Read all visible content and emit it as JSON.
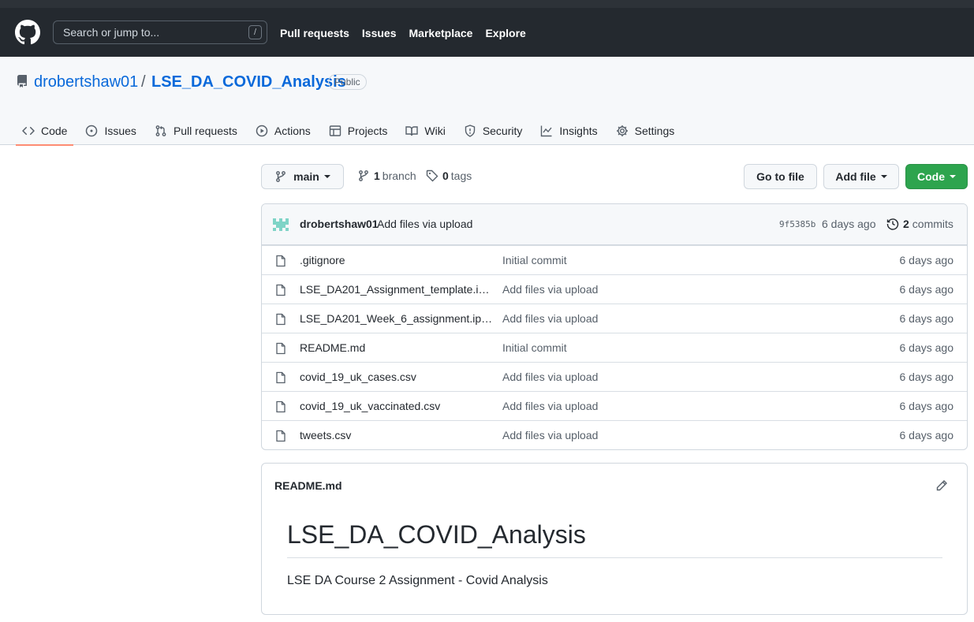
{
  "header": {
    "search_placeholder": "Search or jump to...",
    "search_shortcut": "/",
    "nav": [
      "Pull requests",
      "Issues",
      "Marketplace",
      "Explore"
    ]
  },
  "repo": {
    "owner": "drobertshaw01",
    "separator": "/",
    "name": "LSE_DA_COVID_Analysis",
    "visibility": "Public"
  },
  "tabs": [
    {
      "label": "Code",
      "icon": "code-icon"
    },
    {
      "label": "Issues",
      "icon": "issue-icon"
    },
    {
      "label": "Pull requests",
      "icon": "pull-request-icon"
    },
    {
      "label": "Actions",
      "icon": "play-icon"
    },
    {
      "label": "Projects",
      "icon": "table-icon"
    },
    {
      "label": "Wiki",
      "icon": "book-icon"
    },
    {
      "label": "Security",
      "icon": "shield-icon"
    },
    {
      "label": "Insights",
      "icon": "graph-icon"
    },
    {
      "label": "Settings",
      "icon": "gear-icon"
    }
  ],
  "branch_bar": {
    "branch": "main",
    "branch_count": "1",
    "branch_word": "branch",
    "tag_count": "0",
    "tag_word": "tags",
    "go_to_file": "Go to file",
    "add_file": "Add file",
    "code": "Code"
  },
  "latest_commit": {
    "author": "drobertshaw01",
    "message": "Add files via upload",
    "sha": "9f5385b",
    "time": "6 days ago",
    "commit_count": "2",
    "commit_word": "commits"
  },
  "files": [
    {
      "name": ".gitignore",
      "message": "Initial commit",
      "time": "6 days ago"
    },
    {
      "name": "LSE_DA201_Assignment_template.ipy...",
      "message": "Add files via upload",
      "time": "6 days ago"
    },
    {
      "name": "LSE_DA201_Week_6_assignment.ipynb",
      "message": "Add files via upload",
      "time": "6 days ago"
    },
    {
      "name": "README.md",
      "message": "Initial commit",
      "time": "6 days ago"
    },
    {
      "name": "covid_19_uk_cases.csv",
      "message": "Add files via upload",
      "time": "6 days ago"
    },
    {
      "name": "covid_19_uk_vaccinated.csv",
      "message": "Add files via upload",
      "time": "6 days ago"
    },
    {
      "name": "tweets.csv",
      "message": "Add files via upload",
      "time": "6 days ago"
    }
  ],
  "readme": {
    "filename": "README.md",
    "heading": "LSE_DA_COVID_Analysis",
    "body": "LSE DA Course 2 Assignment - Covid Analysis"
  },
  "colors": {
    "header_bg": "#24292f",
    "link": "#0969da",
    "primary_button": "#2da44e",
    "selected_tab_underline": "#fd8c73"
  }
}
